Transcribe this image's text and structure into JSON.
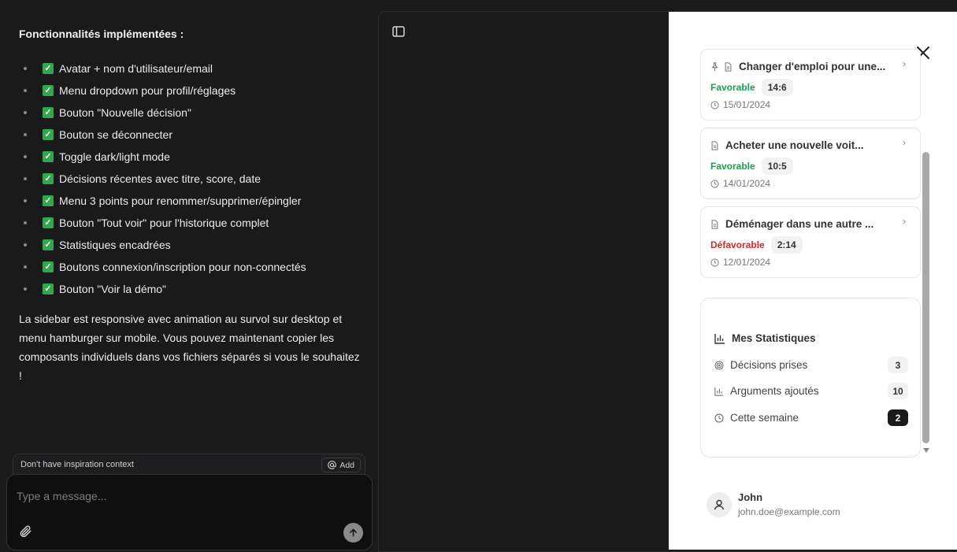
{
  "chat": {
    "title": "Fonctionnalités implémentées :",
    "features": [
      "Avatar + nom d'utilisateur/email",
      "Menu dropdown pour profil/réglages",
      "Bouton \"Nouvelle décision\"",
      "Bouton se déconnecter",
      "Toggle dark/light mode",
      "Décisions récentes avec titre, score, date",
      "Menu 3 points pour renommer/supprimer/épingler",
      "Bouton \"Tout voir\" pour l'historique complet",
      "Statistiques encadrées",
      "Boutons connexion/inscription pour non-connectés",
      "Bouton \"Voir la démo\""
    ],
    "paragraph": "La sidebar est responsive avec animation au survol sur desktop et menu hamburger sur mobile. Vous pouvez maintenant copier les composants individuels dans vos fichiers séparés si vous le souhaitez !",
    "context_text": "Don't have inspiration context",
    "add_label": "Add",
    "message_placeholder": "Type a message..."
  },
  "decisions": [
    {
      "title": "Changer d'emploi pour une...",
      "status": "Favorable",
      "status_color": "#16a34a",
      "score": "14:6",
      "date": "15/01/2024",
      "pinned": true
    },
    {
      "title": "Acheter une nouvelle voit...",
      "status": "Favorable",
      "status_color": "#16a34a",
      "score": "10:5",
      "date": "14/01/2024",
      "pinned": false
    },
    {
      "title": "Déménager dans une autre ...",
      "status": "Défavorable",
      "status_color": "#dc2626",
      "score": "2:14",
      "date": "12/01/2024",
      "pinned": false
    }
  ],
  "stats": {
    "title": "Mes Statistiques",
    "rows": [
      {
        "icon": "target-icon",
        "label": "Décisions prises",
        "count": "3"
      },
      {
        "icon": "bar-chart-icon",
        "label": "Arguments ajoutés",
        "count": "10"
      },
      {
        "icon": "clock-icon",
        "label": "Cette semaine",
        "count": "2"
      }
    ]
  },
  "user": {
    "name": "John",
    "email": "john.doe@example.com"
  }
}
